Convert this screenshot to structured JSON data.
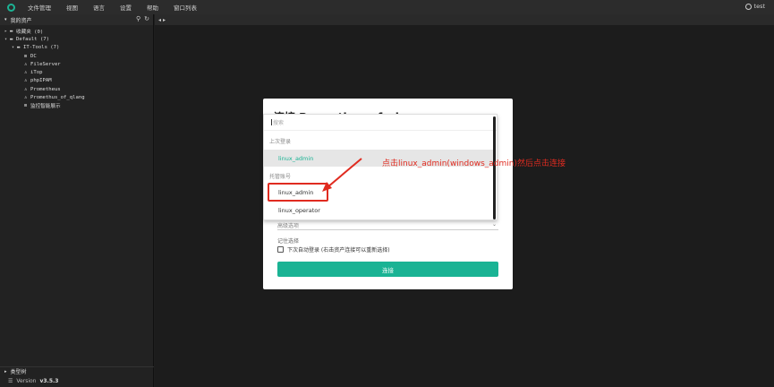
{
  "topbar": {
    "menu": [
      "文件管理",
      "视图",
      "语言",
      "设置",
      "帮助",
      "窗口列表"
    ],
    "user": "test"
  },
  "sidebar": {
    "title": "我的资产",
    "tools": [
      "search-icon",
      "refresh-icon"
    ],
    "tree": [
      {
        "level": 0,
        "arrow": "▸",
        "icon": "folder-icon",
        "glyph": "▬",
        "label": "收藏夹 (0)"
      },
      {
        "level": 0,
        "arrow": "▾",
        "icon": "folder-icon",
        "glyph": "▬",
        "label": "Default (7)"
      },
      {
        "level": 1,
        "arrow": "▾",
        "icon": "folder-icon",
        "glyph": "▬",
        "label": "IT-Tools (7)"
      },
      {
        "level": 2,
        "arrow": "",
        "icon": "windows-icon",
        "glyph": "⊞",
        "label": "DC"
      },
      {
        "level": 2,
        "arrow": "",
        "icon": "linux-icon",
        "glyph": "♙",
        "label": "FileServer"
      },
      {
        "level": 2,
        "arrow": "",
        "icon": "linux-icon",
        "glyph": "♙",
        "label": "iTop"
      },
      {
        "level": 2,
        "arrow": "",
        "icon": "linux-icon",
        "glyph": "♙",
        "label": "phpIPAM"
      },
      {
        "level": 2,
        "arrow": "",
        "icon": "linux-icon",
        "glyph": "♙",
        "label": "Prometheus"
      },
      {
        "level": 2,
        "arrow": "",
        "icon": "linux-icon",
        "glyph": "♙",
        "label": "Promethus_of_qlang"
      },
      {
        "level": 2,
        "arrow": "",
        "icon": "windows-icon",
        "glyph": "⊞",
        "label": "监控智能展示"
      }
    ],
    "footer_type_tree": "类型树",
    "version_label": "Version",
    "version": "v3.5.3"
  },
  "modal": {
    "title": "连接 Promethus_of_qlang",
    "advanced_options": "高级选项",
    "remember_label": "记住选择",
    "auto_login_label": "下次自动登录 (右击资产连接可以重新选择)",
    "connect_button": "连接"
  },
  "dropdown": {
    "search_placeholder": "搜索",
    "group_last_login": "上次登录",
    "last_login_item": "linux_admin",
    "group_managed": "托管账号",
    "items": [
      "linux_admin",
      "linux_operator"
    ]
  },
  "annotation": {
    "text": "点击linux_admin(windows_admin)然后点击连接",
    "color": "#e02b20"
  },
  "colors": {
    "accent": "#1ab394",
    "background": "#1c1c1c"
  }
}
